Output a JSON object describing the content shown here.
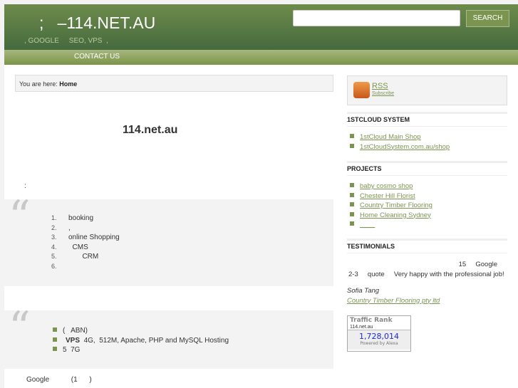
{
  "header": {
    "title": ";   –114.NET.AU",
    "tagline": ", GOOGLE     SEO, VPS  ,",
    "search_placeholder": "",
    "search_label": "SEARCH"
  },
  "nav": {
    "items": [
      "CONTACT US"
    ]
  },
  "breadcrumb": {
    "prefix": "You are here:",
    "current": "Home"
  },
  "main": {
    "title": "114.net.au",
    "colon": ":",
    "list1": [
      "booking",
      ",",
      "online Shopping",
      "  CMS",
      "       CRM",
      ""
    ],
    "list1_nums": [
      "1.",
      "2.",
      "3.",
      "4.",
      "5.",
      "6."
    ],
    "list2": [
      {
        "pre": "(   ABN)",
        "bold": "",
        "post": ""
      },
      {
        "pre": "",
        "bold": "VPS",
        "post": "  4G,  512M, Apache, PHP and MySQL Hosting"
      },
      {
        "pre": "5  7G",
        "bold": "",
        "post": ""
      }
    ],
    "google_line": "Google           (1      )"
  },
  "sidebar": {
    "rss": {
      "label": "RSS",
      "sub": "Subscribe"
    },
    "cloud": {
      "heading": "1STCLOUD SYSTEM",
      "links": [
        "1stCloud Main Shop",
        "1stCloudSystem.com.au/shop"
      ]
    },
    "projects": {
      "heading": "PROJECTS",
      "links": [
        "baby cosmo shop",
        "Chester Hill Florist",
        "Country Timber Flooring",
        "Home Cleaning Sydney",
        "____"
      ]
    },
    "testimonials": {
      "heading": "TESTIMONIALS",
      "line1": "15     Google",
      "line2": "2-3     quote     Very happy with the professional job!",
      "author": "Sofia Tang",
      "company": "Country Timber Flooring pty ltd"
    },
    "alexa": {
      "title": "Traffic Rank",
      "domain": "114.net.au",
      "rank": "1,728,014",
      "powered": "Powered by Alexa"
    }
  },
  "colors": {
    "accent": "#7b9551",
    "header": "#5a7a45"
  }
}
